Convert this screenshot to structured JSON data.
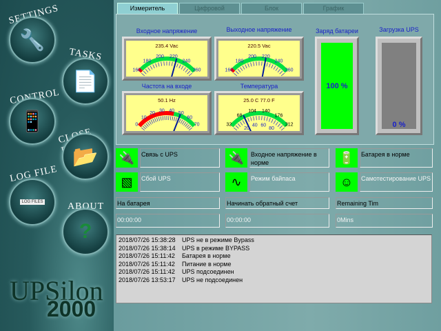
{
  "sidebar": {
    "items": [
      {
        "label": "SETTINGS",
        "icon": "wrench-screwdriver-icon"
      },
      {
        "label": "TASKS",
        "icon": "documents-icon"
      },
      {
        "label": "CONTROL",
        "icon": "remote-control-icon"
      },
      {
        "label": "CLOSE FILE",
        "icon": "folder-arrow-icon"
      },
      {
        "label": "LOG FILE",
        "icon": "file-drawer-icon",
        "drawer_label": "LOG FILES"
      },
      {
        "label": "ABOUT",
        "icon": "question-icon"
      }
    ],
    "logo": {
      "top": "UPSilon",
      "bottom": "2000"
    }
  },
  "tabs": [
    "Измеритель",
    "Цифровой",
    "Блок",
    "График"
  ],
  "gauges": [
    {
      "title": "Входное напряжение",
      "readout": "235.4 Vac",
      "min": 160,
      "max": 260,
      "ticks": [
        160,
        180,
        200,
        220,
        240,
        260
      ],
      "red": [
        160,
        165
      ],
      "green": [
        165,
        260
      ],
      "value": 225.4
    },
    {
      "title": "Выходное напряжение",
      "readout": "220.5 Vac",
      "min": 160,
      "max": 260,
      "ticks": [
        160,
        180,
        200,
        220,
        240,
        260
      ],
      "red": [
        160,
        165
      ],
      "green": [
        165,
        260
      ],
      "value": 220.5
    },
    {
      "title": "Частота на входе",
      "readout": "50.1 Hz",
      "min": 0,
      "max": 70,
      "ticks": [
        0,
        10,
        20,
        30,
        40,
        50,
        60,
        70
      ],
      "red": [
        0,
        43
      ],
      "green": [
        43,
        70
      ],
      "value": 50.1
    },
    {
      "title": "Температура",
      "readout": "25.0 C    77.0 F",
      "min": 0,
      "max": 100,
      "ticks": [
        0,
        20,
        40,
        60,
        80,
        100
      ],
      "ticks_f": [
        32,
        68,
        104,
        140,
        176,
        212
      ],
      "red": [],
      "green": [
        0,
        100
      ],
      "value": 25
    }
  ],
  "battery": {
    "title": "Заряд батареи",
    "label": "100 %",
    "percent": 100,
    "color": "#00ff00"
  },
  "load": {
    "title": "Загрузка UPS",
    "label": "0 %",
    "percent": 0,
    "color": "#808080"
  },
  "status": [
    {
      "icon": "serial-cable-icon",
      "text": "Связь с UPS",
      "active": true
    },
    {
      "icon": "power-plug-icon",
      "text": "Входное напряжение в норме",
      "active": true
    },
    {
      "icon": "battery-icon",
      "text": "Батарея в норме",
      "active": true
    },
    {
      "icon": "ups-unit-icon",
      "text": "Сбой UPS",
      "active": false
    },
    {
      "icon": "sine-wave-icon",
      "text": "Режим байпаса",
      "active": false
    },
    {
      "icon": "self-test-icon",
      "text": "Самотестирование UPS",
      "active": false
    }
  ],
  "timers": [
    {
      "label": "На батарея",
      "value": "00:00:00"
    },
    {
      "label": "Начинать обратный счет",
      "value": "00:00:00"
    },
    {
      "label": "Remaining Tim",
      "value": "0Mins"
    }
  ],
  "log": [
    {
      "time": "2018/07/26 15:38:28",
      "msg": "UPS не в режиме Bypass"
    },
    {
      "time": "2018/07/26 15:38:14",
      "msg": "UPS в режиме BYPASS"
    },
    {
      "time": "2018/07/26 15:11:42",
      "msg": "Батарея в норме"
    },
    {
      "time": "2018/07/26 15:11:42",
      "msg": "Питание в норме"
    },
    {
      "time": "2018/07/26 15:11:42",
      "msg": "UPS подсоединен"
    },
    {
      "time": "2018/07/26 13:53:17",
      "msg": "UPS не подсоединен"
    }
  ]
}
